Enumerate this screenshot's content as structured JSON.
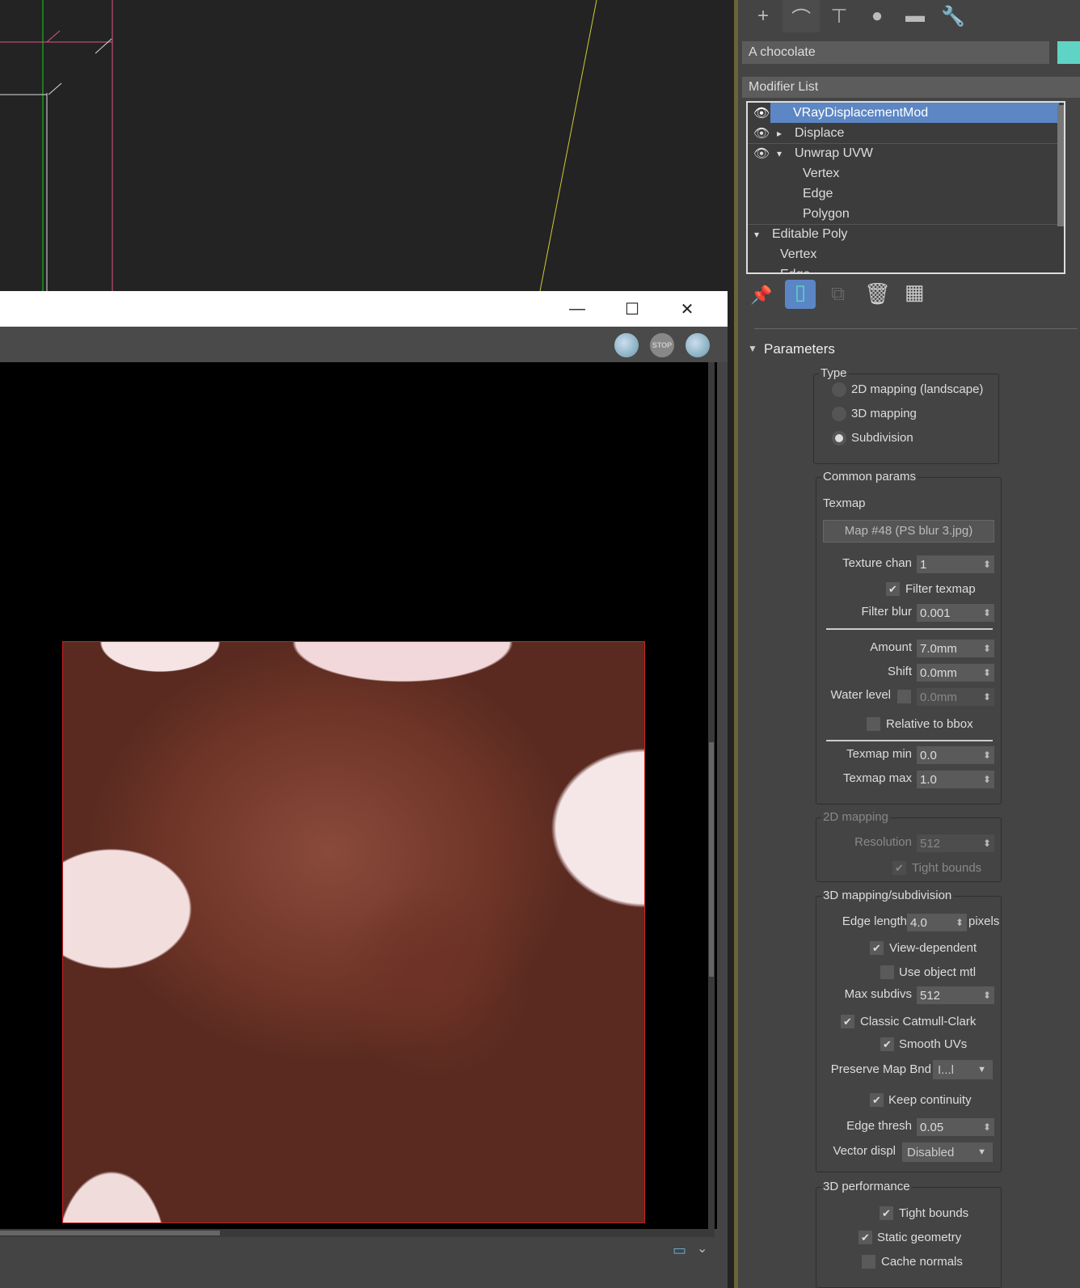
{
  "render_window": {
    "minimize": "—",
    "maximize": "☐",
    "close": "✕",
    "stop_label": "STOP"
  },
  "command_tabs": [
    {
      "icon": "plus-icon",
      "glyph": "+"
    },
    {
      "icon": "modify-icon",
      "glyph": "⌒"
    },
    {
      "icon": "hierarchy-icon",
      "glyph": "⊤"
    },
    {
      "icon": "motion-icon",
      "glyph": "●"
    },
    {
      "icon": "display-icon",
      "glyph": "▬"
    },
    {
      "icon": "utilities-icon",
      "glyph": "🔧"
    }
  ],
  "object_name": "A chocolate",
  "object_color": "#5fd4c4",
  "modifier_list": "Modifier List",
  "stack": [
    "VRayDisplacementMod",
    "Displace",
    "Unwrap UVW",
    "Vertex",
    "Edge",
    "Polygon",
    "Editable Poly",
    "Vertex",
    "Edge"
  ],
  "params": {
    "title": "Parameters",
    "type": {
      "label": "Type",
      "options": [
        "2D mapping (landscape)",
        "3D mapping",
        "Subdivision"
      ],
      "selected": "Subdivision"
    },
    "common": {
      "label": "Common params",
      "texmap_label": "Texmap",
      "texmap": "Map #48 (PS blur 3.jpg)",
      "texture_chan_label": "Texture chan",
      "texture_chan": "1",
      "filter_texmap": "Filter texmap",
      "filter_blur_label": "Filter blur",
      "filter_blur": "0.001",
      "amount_label": "Amount",
      "amount": "7.0mm",
      "shift_label": "Shift",
      "shift": "0.0mm",
      "water_label": "Water level",
      "water": "0.0mm",
      "relative": "Relative to bbox",
      "tmin_label": "Texmap min",
      "tmin": "0.0",
      "tmax_label": "Texmap max",
      "tmax": "1.0"
    },
    "map2d": {
      "label": "2D mapping",
      "res_label": "Resolution",
      "res": "512",
      "tight": "Tight bounds"
    },
    "map3d": {
      "label": "3D mapping/subdivision",
      "edge_label": "Edge length",
      "edge": "4.0",
      "pixels": "pixels",
      "view_dep": "View-dependent",
      "use_obj": "Use object mtl",
      "max_label": "Max subdivs",
      "max": "512",
      "catmull": "Classic Catmull-Clark",
      "smooth": "Smooth UVs",
      "preserve_label": "Preserve Map Bnd",
      "preserve": "I...l",
      "keep": "Keep continuity",
      "thresh_label": "Edge thresh",
      "thresh": "0.05",
      "vector_label": "Vector displ",
      "vector": "Disabled"
    },
    "perf": {
      "label": "3D performance",
      "tight": "Tight bounds",
      "static": "Static geometry",
      "cache": "Cache normals"
    }
  }
}
